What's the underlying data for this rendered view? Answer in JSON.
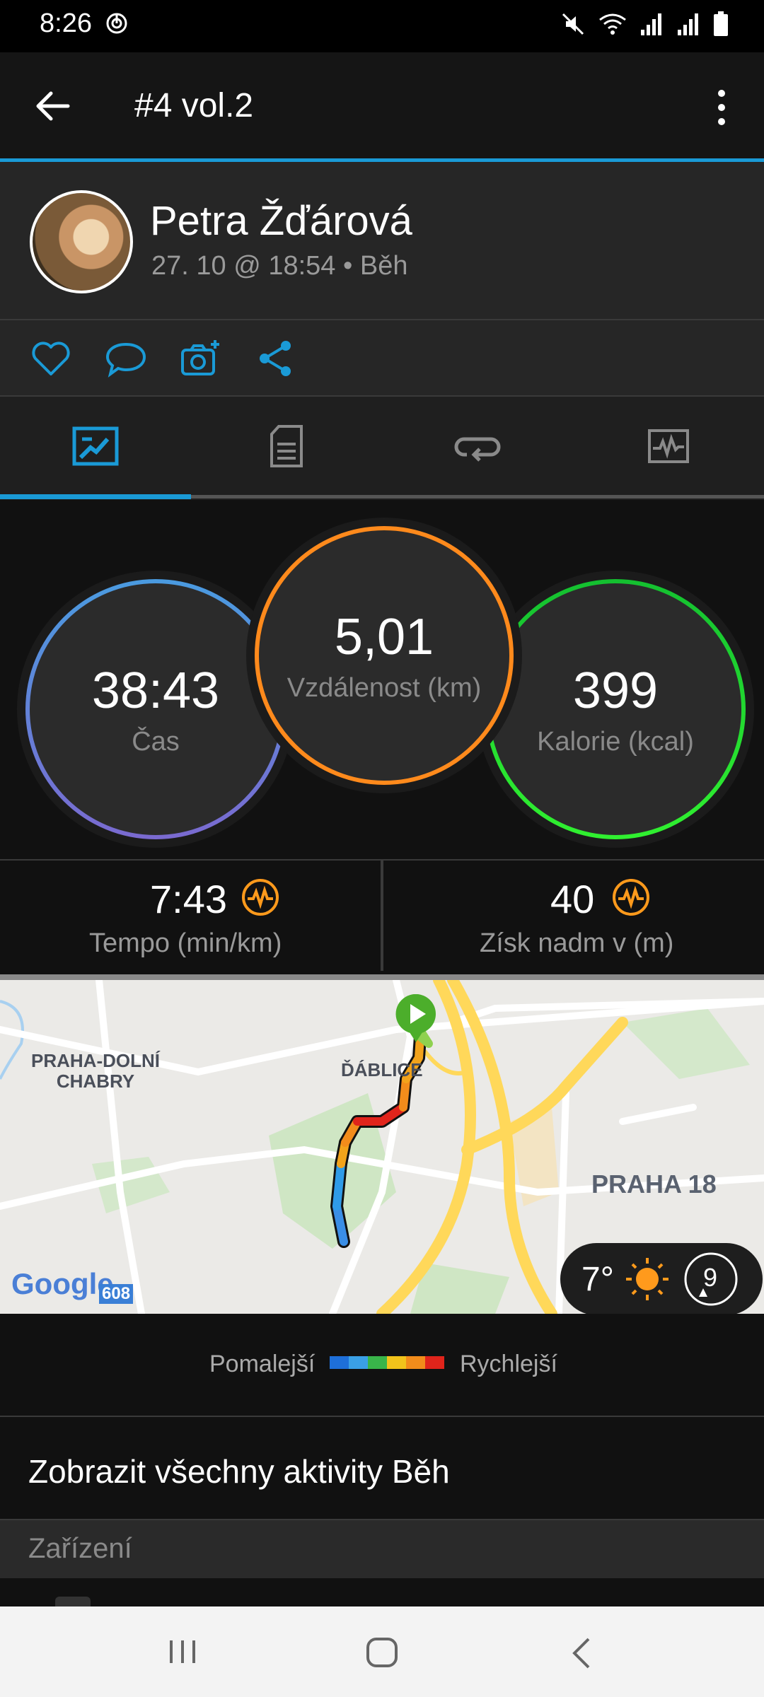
{
  "status_bar": {
    "time": "8:26"
  },
  "app_bar": {
    "title": "#4 vol.2"
  },
  "profile": {
    "name": "Petra Žďárová",
    "meta": "27. 10 @ 18:54 • Běh"
  },
  "stats": {
    "time": {
      "value": "38:43",
      "label": "Čas"
    },
    "distance": {
      "value": "5,01",
      "label": "Vzdálenost (km)"
    },
    "calories": {
      "value": "399",
      "label": "Kalorie (kcal)"
    }
  },
  "substats": {
    "pace": {
      "value": "7:43",
      "label": "Tempo (min/km)"
    },
    "elevation": {
      "value": "40",
      "label": "Získ nadm v (m)"
    }
  },
  "map": {
    "labels": {
      "area1_line1": "PRAHA-DOLNÍ",
      "area1_line2": "CHABRY",
      "area2": "ĎÁBLICE",
      "area3": "PRAHA 18"
    },
    "road_number": "608",
    "google": "Google",
    "weather": {
      "temp": "7°",
      "wind": "9"
    }
  },
  "legend": {
    "slower": "Pomalejší",
    "faster": "Rychlejší",
    "colors": [
      "#1e6fd9",
      "#3aa0e6",
      "#39b54a",
      "#f2c31b",
      "#f28c1b",
      "#e0241b"
    ]
  },
  "all_activities": "Zobrazit všechny aktivity Běh",
  "section": "Zařízení",
  "colors": {
    "accent": "#1a9ad6",
    "time_ring": "#4a9be0",
    "distance_ring": "#ff8a1c",
    "calories_ring": "#22e02a"
  }
}
